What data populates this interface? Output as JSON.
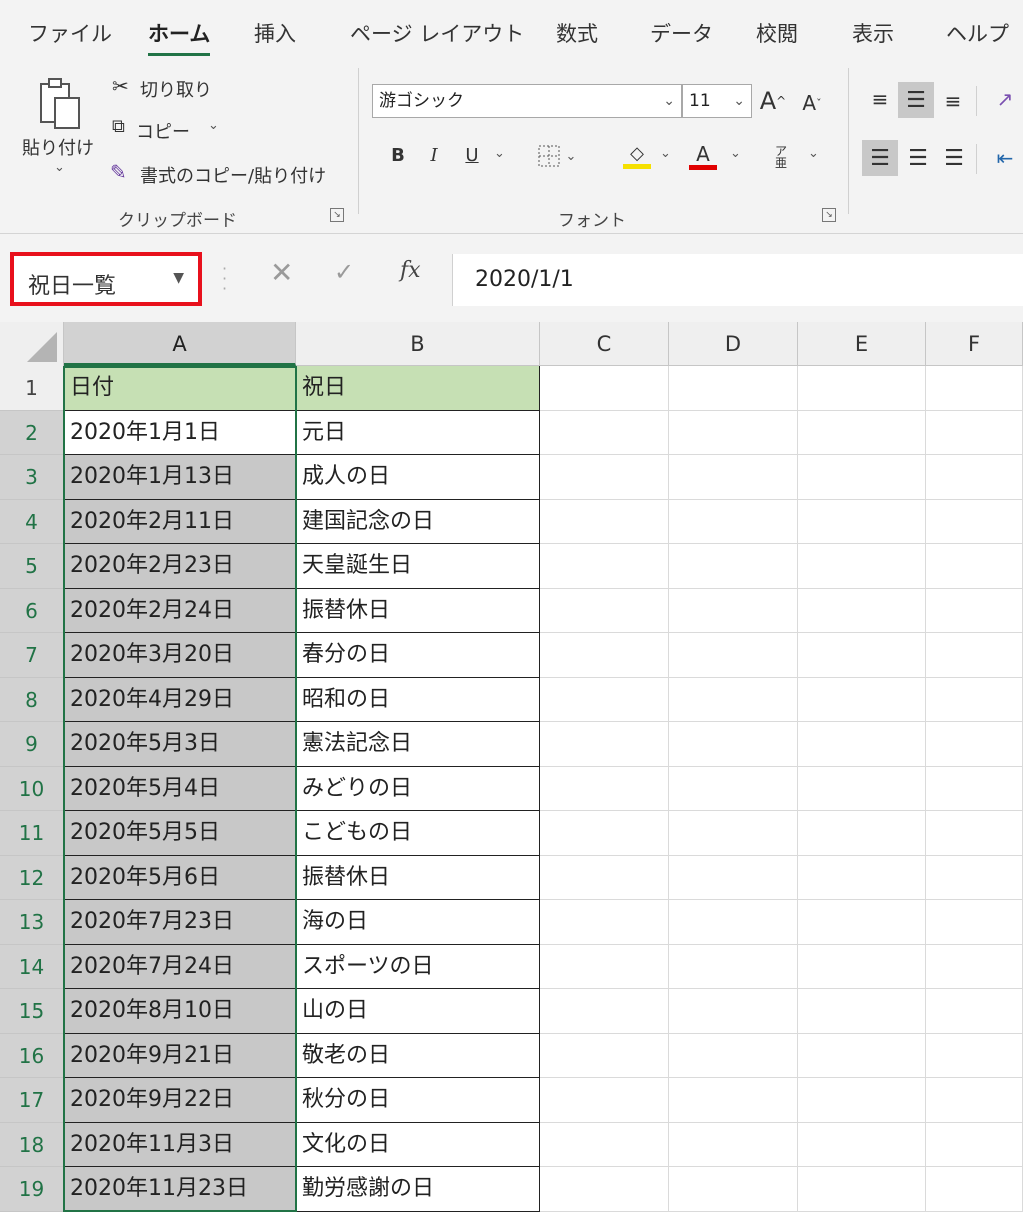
{
  "menu_tabs": [
    {
      "label": "ファイル"
    },
    {
      "label": "ホーム"
    },
    {
      "label": "挿入"
    },
    {
      "label": "ページ レイアウト"
    },
    {
      "label": "数式"
    },
    {
      "label": "データ"
    },
    {
      "label": "校閲"
    },
    {
      "label": "表示"
    },
    {
      "label": "ヘルプ"
    }
  ],
  "clipboard": {
    "paste_label": "貼り付け",
    "cut_label": "切り取り",
    "copy_label": "コピー",
    "format_painter_label": "書式のコピー/貼り付け",
    "group_label": "クリップボード"
  },
  "font": {
    "name": "游ゴシック",
    "size": "11",
    "bold": "B",
    "italic": "I",
    "underline": "U",
    "font_color_glyph": "A",
    "group_label": "フォント",
    "highlight_color": "#f5e000",
    "font_color": "#e00000"
  },
  "formula_bar": {
    "name_box": "祝日一覧",
    "fx": "fx",
    "value": "2020/1/1"
  },
  "columns": [
    "A",
    "B",
    "C",
    "D",
    "E",
    "F"
  ],
  "header_row": [
    "日付",
    "祝日"
  ],
  "rows": [
    {
      "num": "1",
      "a": "日付",
      "b": "祝日"
    },
    {
      "num": "2",
      "a": "2020年1月1日",
      "b": "元日"
    },
    {
      "num": "3",
      "a": "2020年1月13日",
      "b": "成人の日"
    },
    {
      "num": "4",
      "a": "2020年2月11日",
      "b": "建国記念の日"
    },
    {
      "num": "5",
      "a": "2020年2月23日",
      "b": "天皇誕生日"
    },
    {
      "num": "6",
      "a": "2020年2月24日",
      "b": "振替休日"
    },
    {
      "num": "7",
      "a": "2020年3月20日",
      "b": "春分の日"
    },
    {
      "num": "8",
      "a": "2020年4月29日",
      "b": "昭和の日"
    },
    {
      "num": "9",
      "a": "2020年5月3日",
      "b": "憲法記念日"
    },
    {
      "num": "10",
      "a": "2020年5月4日",
      "b": "みどりの日"
    },
    {
      "num": "11",
      "a": "2020年5月5日",
      "b": "こどもの日"
    },
    {
      "num": "12",
      "a": "2020年5月6日",
      "b": "振替休日"
    },
    {
      "num": "13",
      "a": "2020年7月23日",
      "b": "海の日"
    },
    {
      "num": "14",
      "a": "2020年7月24日",
      "b": "スポーツの日"
    },
    {
      "num": "15",
      "a": "2020年8月10日",
      "b": "山の日"
    },
    {
      "num": "16",
      "a": "2020年9月21日",
      "b": "敬老の日"
    },
    {
      "num": "17",
      "a": "2020年9月22日",
      "b": "秋分の日"
    },
    {
      "num": "18",
      "a": "2020年11月3日",
      "b": "文化の日"
    },
    {
      "num": "19",
      "a": "2020年11月23日",
      "b": "勤労感謝の日"
    }
  ],
  "colors": {
    "excel_green": "#217346",
    "header_fill": "#c6e0b4",
    "namebox_highlight": "#e8101c"
  }
}
